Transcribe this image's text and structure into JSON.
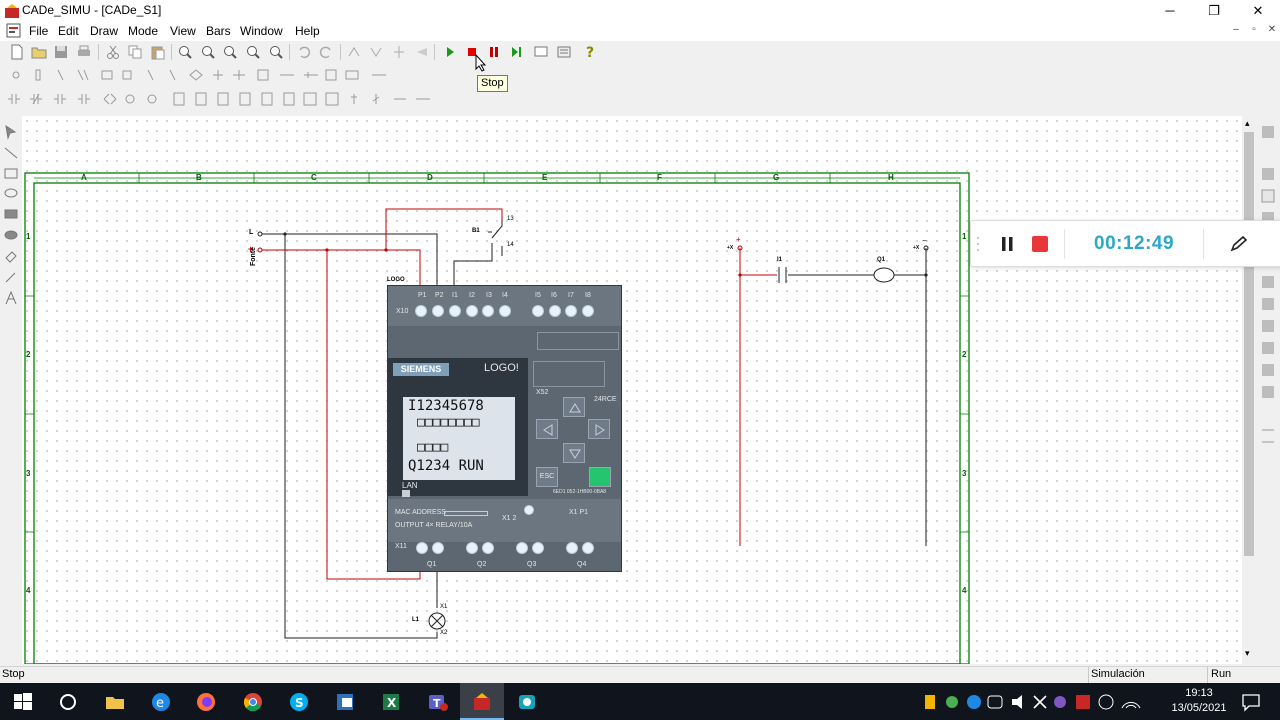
{
  "window": {
    "title": "CADe_SIMU - [CADe_S1]",
    "minimize_glyph": "─",
    "restore_glyph": "❐",
    "close_glyph": "✕"
  },
  "menu": {
    "items": [
      "File",
      "Edit",
      "Draw",
      "Mode",
      "View",
      "Bars",
      "Window",
      "Help"
    ],
    "mdi_minimize": "–",
    "mdi_restore": "▫",
    "mdi_close": "✕"
  },
  "toolbar": {
    "tooltip": "Stop",
    "run_color": "#1a9a1a",
    "stop_color": "#e00000",
    "pause_color": "#c00000",
    "help_color": "#8a8a00"
  },
  "grid": {
    "columns": [
      "A",
      "B",
      "C",
      "D",
      "E",
      "F",
      "G",
      "H"
    ],
    "rows": [
      "1",
      "2",
      "3",
      "4"
    ],
    "frame_color": "#008000"
  },
  "schematic": {
    "supply_l": "L",
    "supply_plus": "+",
    "supply_label": "Fonte",
    "switch_label": "B1",
    "switch_top": "13",
    "switch_bottom": "14",
    "logo_header": "LOGO",
    "lamp_label": "L1",
    "lamp_x1": "X1",
    "lamp_x2": "X2",
    "ladder_plus": "+",
    "ladder_minus": "−",
    "ladder_i1": "I1",
    "ladder_q1": "Q1",
    "ladder_left_terminal": "+X",
    "ladder_right_terminal": "+X",
    "wire_red": "#c00000",
    "wire_black": "#202020"
  },
  "logo_module": {
    "brand": "SIEMENS",
    "name": "LOGO!",
    "connector_top": "X10",
    "inputs": [
      "P1",
      "P2",
      "I1",
      "I2",
      "I3",
      "I4",
      "I5",
      "I6",
      "I7",
      "I8"
    ],
    "model": "24RCE",
    "xs_label": "X52",
    "order_no": "6ED1 052-1HB00-0BA8",
    "lan": "LAN",
    "mac": "MAC ADDRESS",
    "output_spec": "OUTPUT 4× RELAY/10A",
    "x12": "X1 2",
    "x1p1": "X1 P1",
    "x11": "X11",
    "outputs": [
      "Q1",
      "Q2",
      "Q3",
      "Q4"
    ],
    "lcd_line1": "I12345678",
    "lcd_line2": "□□□□□□□□",
    "lcd_line3": "□□□□",
    "lcd_line4": "Q1234 RUN",
    "esc": "ESC",
    "led_color": "#25c46e"
  },
  "recorder": {
    "timer": "00:12:49",
    "stop_color": "#e8363a"
  },
  "status": {
    "left": "Stop",
    "mode": "Simulación",
    "state": "Run"
  },
  "taskbar": {
    "time": "19:13",
    "date": "13/05/2021"
  }
}
